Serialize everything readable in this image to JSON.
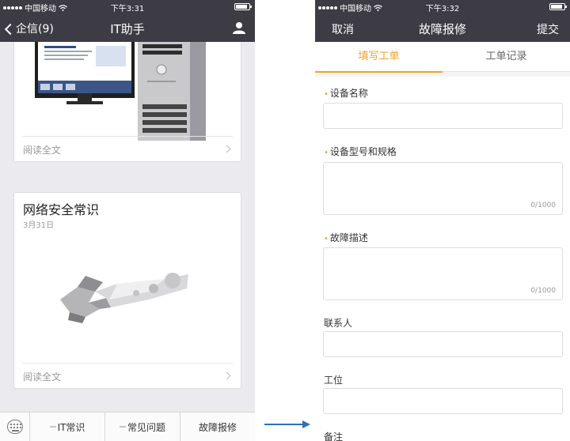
{
  "left_phone": {
    "status": {
      "carrier": "中国移动",
      "time": "下午3:31"
    },
    "nav": {
      "back_label": "企信(9)",
      "title": "IT助手"
    },
    "cards": [
      {
        "read_more": "阅读全文"
      },
      {
        "title": "网络安全常识",
        "date": "3月31日",
        "read_more": "阅读全文"
      }
    ],
    "menu": [
      "IT常识",
      "常见问题",
      "故障报修"
    ]
  },
  "right_phone": {
    "status": {
      "carrier": "中国移动",
      "time": "下午3:32"
    },
    "nav": {
      "cancel": "取消",
      "title": "故障报修",
      "submit": "提交"
    },
    "tabs": [
      "填写工单",
      "工单记录"
    ],
    "active_tab": "填写工单",
    "form": {
      "required_mark": "•",
      "device_name_label": "设备名称",
      "device_model_label": "设备型号和规格",
      "device_model_counter": "0/1000",
      "fault_desc_label": "故障描述",
      "fault_desc_counter": "0/1000",
      "contact_label": "联系人",
      "workstation_label": "工位",
      "remarks_label": "备注"
    }
  },
  "colors": {
    "navbar": "#3d3c45",
    "accent": "#f4a22d",
    "arrow": "#2f6fb8"
  }
}
